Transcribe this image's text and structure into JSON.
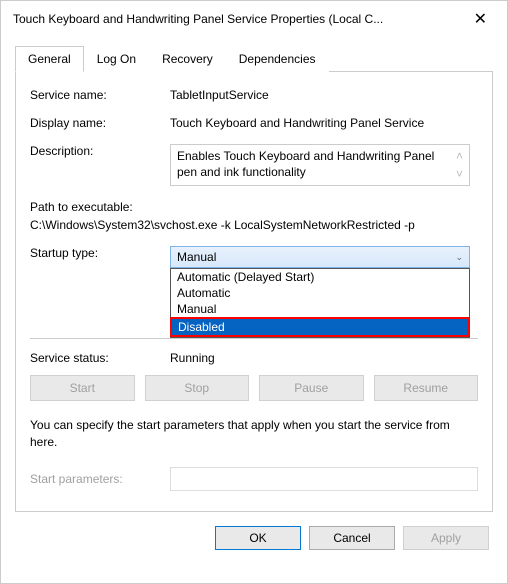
{
  "window": {
    "title": "Touch Keyboard and Handwriting Panel Service Properties (Local C..."
  },
  "tabs": {
    "general": "General",
    "logon": "Log On",
    "recovery": "Recovery",
    "dependencies": "Dependencies"
  },
  "general": {
    "service_name_label": "Service name:",
    "service_name_value": "TabletInputService",
    "display_name_label": "Display name:",
    "display_name_value": "Touch Keyboard and Handwriting Panel Service",
    "description_label": "Description:",
    "description_value": "Enables Touch Keyboard and Handwriting Panel pen and ink functionality",
    "path_label": "Path to executable:",
    "path_value": "C:\\Windows\\System32\\svchost.exe -k LocalSystemNetworkRestricted -p",
    "startup_label": "Startup type:",
    "startup_selected": "Manual",
    "startup_options": {
      "delayed": "Automatic (Delayed Start)",
      "automatic": "Automatic",
      "manual": "Manual",
      "disabled": "Disabled"
    },
    "status_label": "Service status:",
    "status_value": "Running",
    "buttons": {
      "start": "Start",
      "stop": "Stop",
      "pause": "Pause",
      "resume": "Resume"
    },
    "hint": "You can specify the start parameters that apply when you start the service from here.",
    "params_label": "Start parameters:",
    "params_value": ""
  },
  "footer": {
    "ok": "OK",
    "cancel": "Cancel",
    "apply": "Apply"
  }
}
